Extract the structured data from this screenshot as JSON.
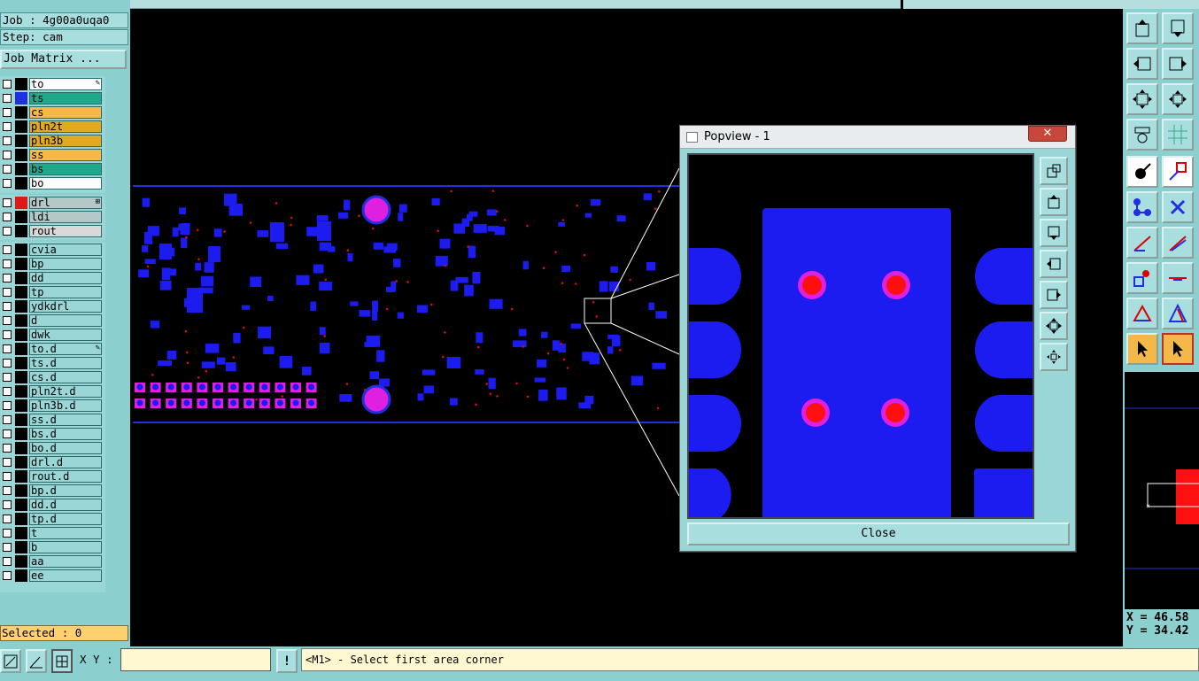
{
  "job_label": "Job : 4g00a0uqa0",
  "step_label": "Step: cam",
  "job_matrix_button": "Job Matrix ...",
  "layers_board": [
    {
      "name": "to",
      "color": "#000000",
      "fill": "#ffffff",
      "mark": "✎"
    },
    {
      "name": "ts",
      "color": "#2030e0",
      "fill": "#1fa88a",
      "mark": ""
    },
    {
      "name": "cs",
      "color": "#000000",
      "fill": "#f5b84a",
      "mark": ""
    },
    {
      "name": "pln2t",
      "color": "#000000",
      "fill": "#e0a91e",
      "mark": ""
    },
    {
      "name": "pln3b",
      "color": "#000000",
      "fill": "#e0a91e",
      "mark": ""
    },
    {
      "name": "ss",
      "color": "#000000",
      "fill": "#f5b84a",
      "mark": ""
    },
    {
      "name": "bs",
      "color": "#000000",
      "fill": "#1fa88a",
      "mark": ""
    },
    {
      "name": "bo",
      "color": "#000000",
      "fill": "#ffffff",
      "mark": ""
    }
  ],
  "layers_drill": [
    {
      "name": "drl",
      "color": "#e01818",
      "fill": "#b4c8c8",
      "mark": "⊞"
    },
    {
      "name": "ldi",
      "color": "#000000",
      "fill": "#b4c8c8",
      "mark": ""
    },
    {
      "name": "rout",
      "color": "#000000",
      "fill": "#d9d9d9",
      "mark": ""
    }
  ],
  "layers_misc": [
    {
      "name": "cvia",
      "mark": ""
    },
    {
      "name": "bp",
      "mark": ""
    },
    {
      "name": "dd",
      "mark": ""
    },
    {
      "name": "tp",
      "mark": ""
    },
    {
      "name": "ydkdrl",
      "mark": ""
    },
    {
      "name": "d",
      "mark": ""
    },
    {
      "name": "dwk",
      "mark": ""
    },
    {
      "name": "to.d",
      "mark": "✎"
    },
    {
      "name": "ts.d",
      "mark": ""
    },
    {
      "name": "cs.d",
      "mark": ""
    },
    {
      "name": "pln2t.d",
      "mark": ""
    },
    {
      "name": "pln3b.d",
      "mark": ""
    },
    {
      "name": "ss.d",
      "mark": ""
    },
    {
      "name": "bs.d",
      "mark": ""
    },
    {
      "name": "bo.d",
      "mark": ""
    },
    {
      "name": "drl.d",
      "mark": ""
    },
    {
      "name": "rout.d",
      "mark": ""
    },
    {
      "name": "bp.d",
      "mark": ""
    },
    {
      "name": "dd.d",
      "mark": ""
    },
    {
      "name": "tp.d",
      "mark": ""
    },
    {
      "name": "t",
      "mark": ""
    },
    {
      "name": "b",
      "mark": ""
    },
    {
      "name": "aa",
      "mark": ""
    },
    {
      "name": "ee",
      "mark": ""
    }
  ],
  "selected_label": "Selected : 0",
  "coords": {
    "x": "X = 46.58",
    "y": "Y = 34.42"
  },
  "bottom": {
    "xy_label": "X Y :",
    "xy_value": "",
    "prompt": "<M1> - Select first area corner"
  },
  "popview": {
    "title": "Popview - 1",
    "close_x": "✕",
    "close_button": "Close"
  },
  "colors": {
    "pad": "#1c1cf0",
    "via": "#e020e0",
    "drill": "#ff1010",
    "panel": "#8ccfcf"
  }
}
